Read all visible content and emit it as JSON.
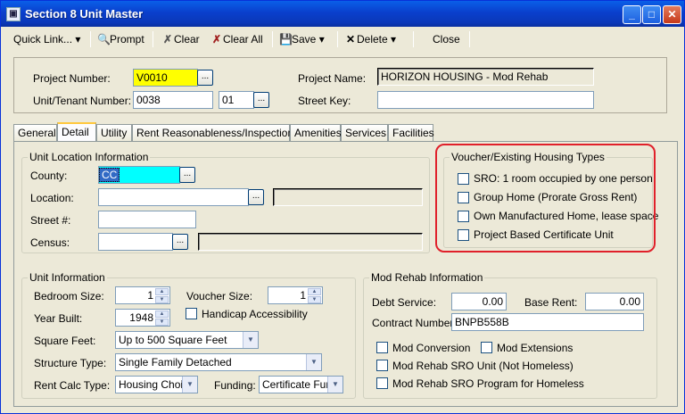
{
  "window": {
    "title": "Section 8 Unit Master"
  },
  "toolbar": {
    "quick_link": "Quick Link...",
    "prompt": "Prompt",
    "clear": "Clear",
    "clear_all": "Clear All",
    "save": "Save",
    "delete": "Delete",
    "close": "Close"
  },
  "header": {
    "project_number_label": "Project Number:",
    "project_number": "V0010",
    "project_name_label": "Project Name:",
    "project_name": "HORIZON HOUSING - Mod Rehab",
    "unit_tenant_label": "Unit/Tenant Number:",
    "unit_number": "0038",
    "tenant_number": "01",
    "street_key_label": "Street Key:",
    "street_key": ""
  },
  "tabs": [
    "General",
    "Detail",
    "Utility",
    "Rent Reasonableness/Inspections",
    "Amenities",
    "Services",
    "Facilities"
  ],
  "active_tab": "Detail",
  "unit_location": {
    "title": "Unit Location Information",
    "county_label": "County:",
    "county": "CC",
    "location_label": "Location:",
    "location": "",
    "street_label": "Street #:",
    "street": "",
    "census_label": "Census:",
    "census": ""
  },
  "voucher": {
    "title": "Voucher/Existing Housing Types",
    "items": [
      "SRO: 1 room occupied by one person",
      "Group Home (Prorate Gross Rent)",
      "Own Manufactured Home, lease space",
      "Project Based Certificate Unit"
    ]
  },
  "unit_info": {
    "title": "Unit Information",
    "bedroom_label": "Bedroom Size:",
    "bedroom": "1",
    "voucher_label": "Voucher Size:",
    "voucher": "1",
    "year_label": "Year Built:",
    "year": "1948",
    "handicap_label": "Handicap Accessibility",
    "sqft_label": "Square Feet:",
    "sqft": "Up to 500 Square Feet",
    "structure_label": "Structure Type:",
    "structure": "Single Family Detached",
    "rentcalc_label": "Rent Calc Type:",
    "rentcalc": "Housing Choice",
    "funding_label": "Funding:",
    "funding": "Certificate Func"
  },
  "mod_rehab": {
    "title": "Mod Rehab Information",
    "debt_label": "Debt Service:",
    "debt": "0.00",
    "base_label": "Base Rent:",
    "base": "0.00",
    "contract_label": "Contract Number:",
    "contract": "BNPB558B",
    "mod_conversion": "Mod Conversion",
    "mod_extensions": "Mod Extensions",
    "sro_unit": "Mod Rehab SRO Unit (Not Homeless)",
    "sro_program": "Mod Rehab SRO Program for Homeless"
  },
  "colors": {
    "highlight_yellow": "#ffff00",
    "highlight_cyan": "#00ffff",
    "annotation_red": "#e0202a"
  }
}
